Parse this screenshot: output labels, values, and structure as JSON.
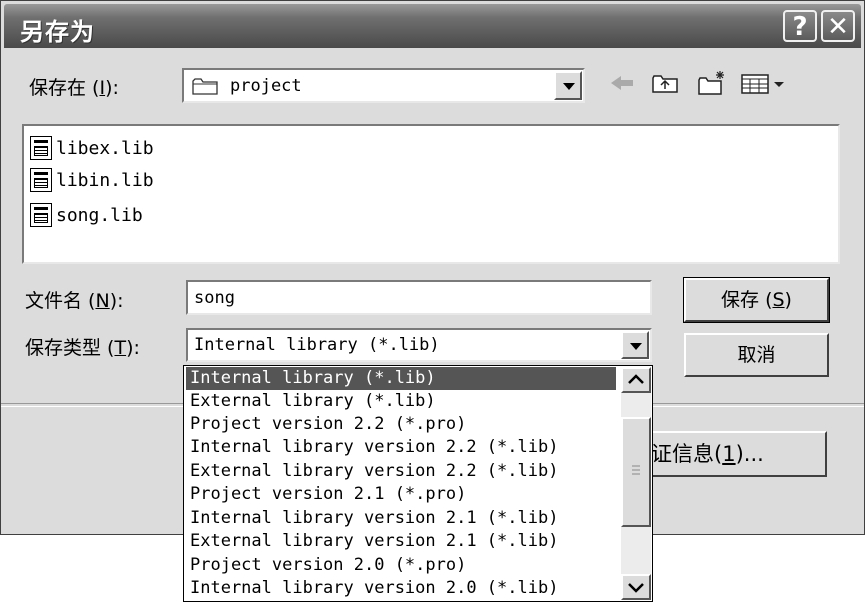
{
  "title": "另存为",
  "title_buttons": {
    "help": "?",
    "close": "✕"
  },
  "save_in": {
    "label": "保存在",
    "hotkey": "I",
    "value": "project"
  },
  "files": [
    {
      "name": "libex.lib"
    },
    {
      "name": "libin.lib"
    },
    {
      "name": "song.lib"
    }
  ],
  "filename": {
    "label": "文件名",
    "hotkey": "N",
    "value": "song"
  },
  "filetype": {
    "label": "保存类型",
    "hotkey": "T",
    "value": "Internal library (*.lib)"
  },
  "buttons": {
    "save": "保存",
    "save_hotkey": "S",
    "cancel": "取消",
    "cert": "证信息",
    "cert_hotkey": "1",
    "cert_suffix": "..."
  },
  "filetype_options": [
    "Internal library (*.lib)",
    "External library (*.lib)",
    "Project version 2.2 (*.pro)",
    "Internal library version 2.2 (*.lib)",
    "External library version 2.2 (*.lib)",
    "Project version 2.1 (*.pro)",
    "Internal library version 2.1 (*.lib)",
    "External library version 2.1 (*.lib)",
    "Project version 2.0 (*.pro)",
    "Internal library version 2.0 (*.lib)"
  ],
  "selected_option_index": 0,
  "icons": [
    "back-arrow-icon",
    "up-folder-icon",
    "new-folder-icon",
    "view-menu-icon",
    "folder-icon",
    "lib-file-icon"
  ],
  "colors": {
    "selection": "#555555",
    "title_bar": "#6a6a6a"
  }
}
